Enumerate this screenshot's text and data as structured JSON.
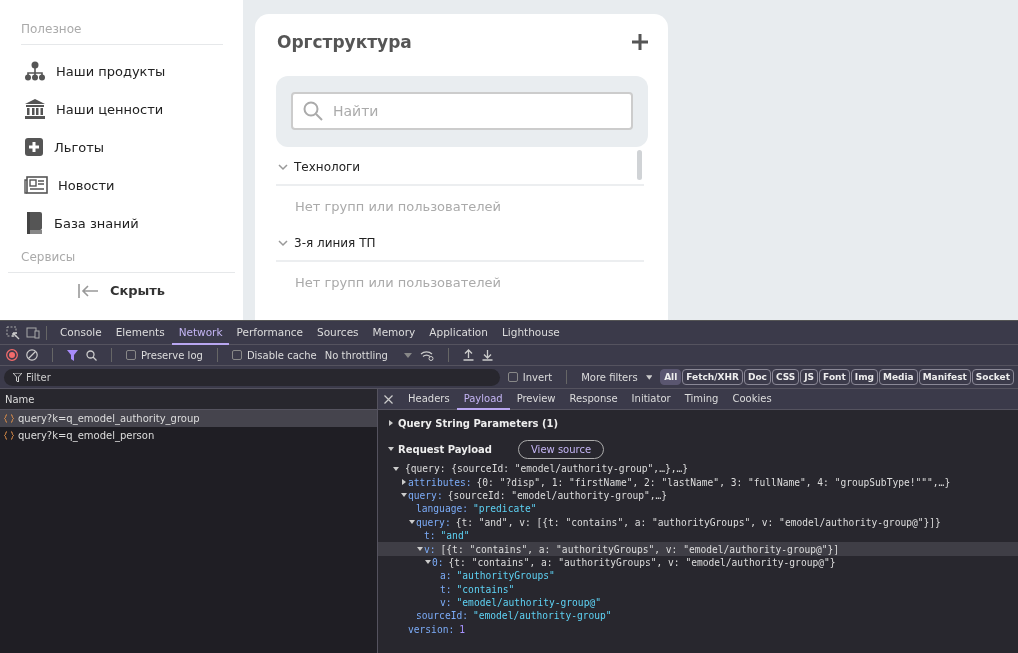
{
  "sidebar": {
    "sections": [
      {
        "title": "Полезное",
        "items": [
          {
            "label": "Наши продукты"
          },
          {
            "label": "Наши ценности"
          },
          {
            "label": "Льготы"
          },
          {
            "label": "Новости"
          },
          {
            "label": "База знаний"
          }
        ]
      },
      {
        "title": "Сервисы"
      }
    ],
    "collapse_label": "Скрыть"
  },
  "org": {
    "title": "Оргструктура",
    "search_placeholder": "Найти",
    "groups": [
      {
        "label": "Технологи",
        "expanded": true,
        "empty_text": "Нет групп или пользователей"
      },
      {
        "label": "3-я линия ТП",
        "expanded": true,
        "empty_text": "Нет групп или пользователей"
      }
    ]
  },
  "devtools": {
    "tabs": [
      {
        "label": "Console",
        "selected": false
      },
      {
        "label": "Elements",
        "selected": false
      },
      {
        "label": "Network",
        "selected": true
      },
      {
        "label": "Performance",
        "selected": false
      },
      {
        "label": "Sources",
        "selected": false
      },
      {
        "label": "Memory",
        "selected": false
      },
      {
        "label": "Application",
        "selected": false
      },
      {
        "label": "Lighthouse",
        "selected": false
      }
    ],
    "toolbar": {
      "preserve_log": {
        "label": "Preserve log",
        "checked": false
      },
      "disable_cache": {
        "label": "Disable cache",
        "checked": false
      },
      "throttling": "No throttling"
    },
    "filter": {
      "placeholder": "Filter",
      "invert": {
        "label": "Invert",
        "checked": false
      },
      "more_filters": "More filters",
      "types": [
        {
          "label": "All",
          "selected": true
        },
        {
          "label": "Fetch/XHR",
          "selected": false
        },
        {
          "label": "Doc",
          "selected": false
        },
        {
          "label": "CSS",
          "selected": false
        },
        {
          "label": "JS",
          "selected": false
        },
        {
          "label": "Font",
          "selected": false
        },
        {
          "label": "Img",
          "selected": false
        },
        {
          "label": "Media",
          "selected": false
        },
        {
          "label": "Manifest",
          "selected": false
        },
        {
          "label": "Socket",
          "selected": false
        }
      ]
    },
    "requests": {
      "column": "Name",
      "rows": [
        {
          "name": "query?k=q_emodel_authority_group",
          "selected": true
        },
        {
          "name": "query?k=q_emodel_person",
          "selected": false
        }
      ]
    },
    "detail": {
      "tabs": [
        {
          "label": "Headers",
          "selected": false
        },
        {
          "label": "Payload",
          "selected": true
        },
        {
          "label": "Preview",
          "selected": false
        },
        {
          "label": "Response",
          "selected": false
        },
        {
          "label": "Initiator",
          "selected": false
        },
        {
          "label": "Timing",
          "selected": false
        },
        {
          "label": "Cookies",
          "selected": false
        }
      ],
      "sections": [
        {
          "title": "Query String Parameters (1)",
          "expanded": false
        },
        {
          "title": "Request Payload",
          "expanded": true,
          "button": "View source"
        }
      ],
      "payload": [
        {
          "value": "{query: {sourceId: \"emodel/authority-group\",…},…}",
          "kind": "preview",
          "expanded": true,
          "selected": false,
          "children": [
            {
              "key": "attributes:",
              "value": "{0: \"?disp\", 1: \"firstName\", 2: \"lastName\", 3: \"fullName\", 4: \"groupSubType!\"\"\",…}",
              "kind": "preview",
              "expanded": false,
              "selected": false
            },
            {
              "key": "query:",
              "value": "{sourceId: \"emodel/authority-group\",…}",
              "kind": "preview",
              "expanded": true,
              "selected": false,
              "children": [
                {
                  "key": "language:",
                  "value": "\"predicate\"",
                  "kind": "string",
                  "selected": false
                },
                {
                  "key": "query:",
                  "value": "{t: \"and\", v: [{t: \"contains\", a: \"authorityGroups\", v: \"emodel/authority-group@\"}]}",
                  "kind": "preview",
                  "expanded": true,
                  "selected": false,
                  "children": [
                    {
                      "key": "t:",
                      "value": "\"and\"",
                      "kind": "string",
                      "selected": false
                    },
                    {
                      "key": "v:",
                      "value": "[{t: \"contains\", a: \"authorityGroups\", v: \"emodel/authority-group@\"}]",
                      "kind": "preview",
                      "expanded": true,
                      "selected": true,
                      "children": [
                        {
                          "key": "0:",
                          "value": "{t: \"contains\", a: \"authorityGroups\", v: \"emodel/authority-group@\"}",
                          "kind": "preview",
                          "expanded": true,
                          "selected": false,
                          "children": [
                            {
                              "key": "a:",
                              "value": "\"authorityGroups\"",
                              "kind": "string",
                              "selected": false
                            },
                            {
                              "key": "t:",
                              "value": "\"contains\"",
                              "kind": "string",
                              "selected": false
                            },
                            {
                              "key": "v:",
                              "value": "\"emodel/authority-group@\"",
                              "kind": "string",
                              "selected": false
                            }
                          ]
                        }
                      ]
                    }
                  ]
                },
                {
                  "key": "sourceId:",
                  "value": "\"emodel/authority-group\"",
                  "kind": "string",
                  "selected": false
                }
              ]
            },
            {
              "key": "version:",
              "value": "1",
              "kind": "number",
              "selected": false
            }
          ]
        }
      ]
    }
  }
}
